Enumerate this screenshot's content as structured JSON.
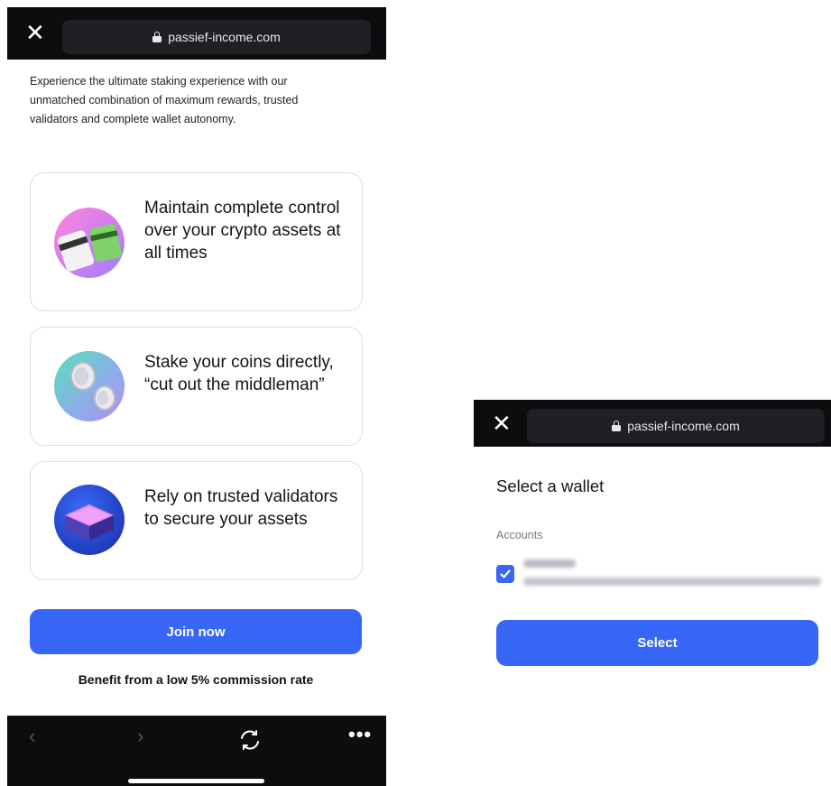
{
  "left_screen": {
    "topbar": {
      "close_label": "✕",
      "url": "passief-income.com"
    },
    "intro": "Experience the ultimate staking experience with our unmatched combination of maximum rewards, trusted validators and complete wallet autonomy.",
    "cards": [
      {
        "text": "Maintain complete control over your crypto assets at all times",
        "icon": "cards-illustration"
      },
      {
        "text": "Stake your coins directly, “cut out the middleman”",
        "icon": "coins-illustration"
      },
      {
        "text": "Rely on trusted validators to secure your assets",
        "icon": "validator-block-illustration"
      }
    ],
    "join_button": "Join now",
    "benefit": "Benefit from a low 5% commission rate",
    "bottombar": {
      "back": "‹",
      "forward": "›",
      "more": "•••"
    }
  },
  "right_screen": {
    "topbar": {
      "close_label": "✕",
      "url": "passief-income.com"
    },
    "title": "Select a wallet",
    "accounts_label": "Accounts",
    "account_checked": true,
    "select_button": "Select"
  },
  "colors": {
    "accent": "#3866f7",
    "topbar": "#0d0d0f"
  }
}
